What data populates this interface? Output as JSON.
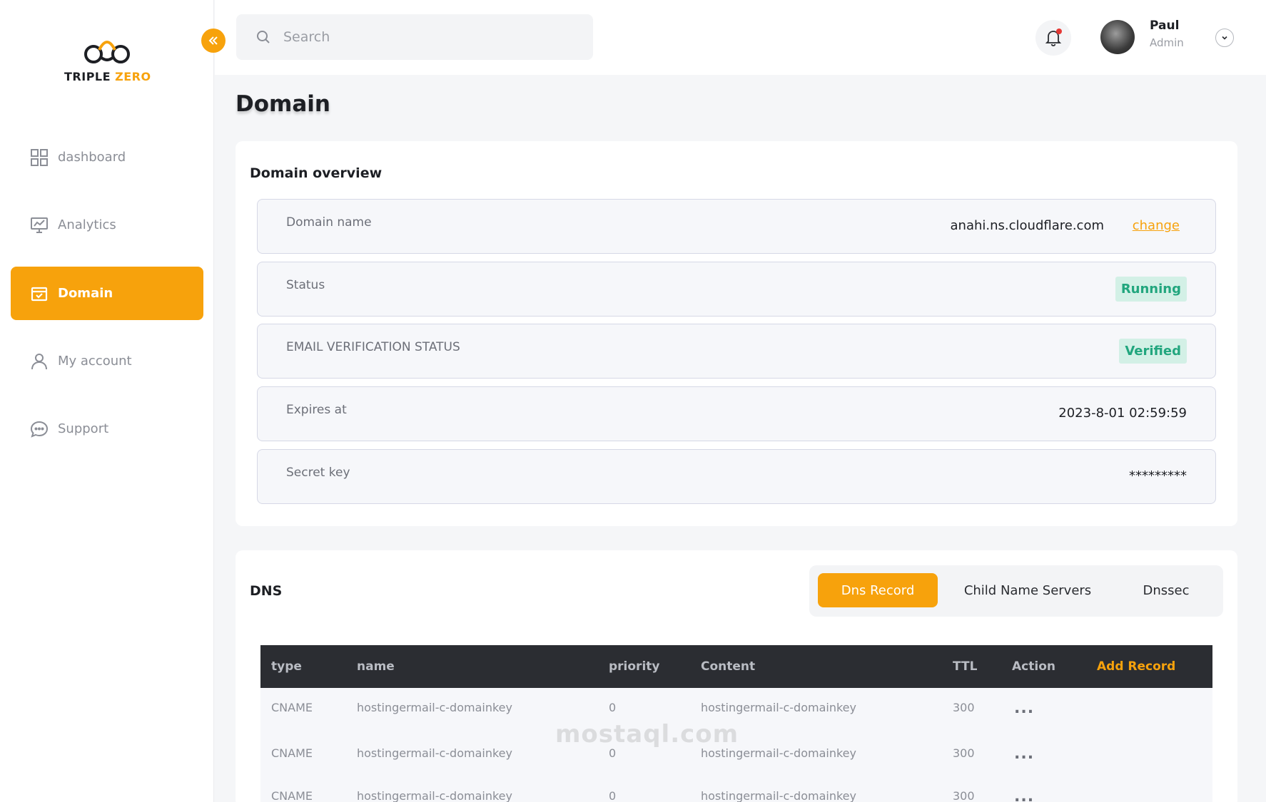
{
  "brand": {
    "logo_word": "TRIPLE",
    "logo_accent": "ZERO",
    "accent_color": "#f7a20c"
  },
  "sidebar": {
    "items": [
      {
        "label": "dashboard",
        "icon": "grid-icon"
      },
      {
        "label": "Analytics",
        "icon": "monitor-chart-icon"
      },
      {
        "label": "Domain",
        "icon": "calendar-check-icon",
        "active": true
      },
      {
        "label": "My account",
        "icon": "user-icon"
      },
      {
        "label": "Support",
        "icon": "chat-icon"
      }
    ]
  },
  "topbar": {
    "search_placeholder": "Search",
    "user": {
      "name": "Paul",
      "role": "Admin"
    }
  },
  "page": {
    "title": "Domain"
  },
  "overview": {
    "title": "Domain overview",
    "rows": [
      {
        "label": "Domain name",
        "value": "anahi.ns.cloudflare.com",
        "action": "change"
      },
      {
        "label": "Status",
        "badge": "Running"
      },
      {
        "label": "EMAIL VERIFICATION STATUS",
        "badge": "Verified"
      },
      {
        "label": "Expires at",
        "value": "2023-8-01 02:59:59"
      },
      {
        "label": "Secret key",
        "value": "*********"
      }
    ]
  },
  "dns": {
    "title": "DNS",
    "tabs": [
      "Dns Record",
      "Child Name Servers",
      "Dnssec"
    ],
    "columns": [
      "type",
      "name",
      "priority",
      "Content",
      "TTL",
      "Action"
    ],
    "add_label": "Add Record",
    "rows": [
      {
        "type": "CNAME",
        "name": "hostingermail-c-domainkey",
        "priority": "0",
        "content": "hostingermail-c-domainkey",
        "ttl": "300",
        "action": "..."
      },
      {
        "type": "CNAME",
        "name": "hostingermail-c-domainkey",
        "priority": "0",
        "content": "hostingermail-c-domainkey",
        "ttl": "300",
        "action": "..."
      },
      {
        "type": "CNAME",
        "name": "hostingermail-c-domainkey",
        "priority": "0",
        "content": "hostingermail-c-domainkey",
        "ttl": "300",
        "action": "..."
      }
    ]
  },
  "watermark": "mostaql.com"
}
